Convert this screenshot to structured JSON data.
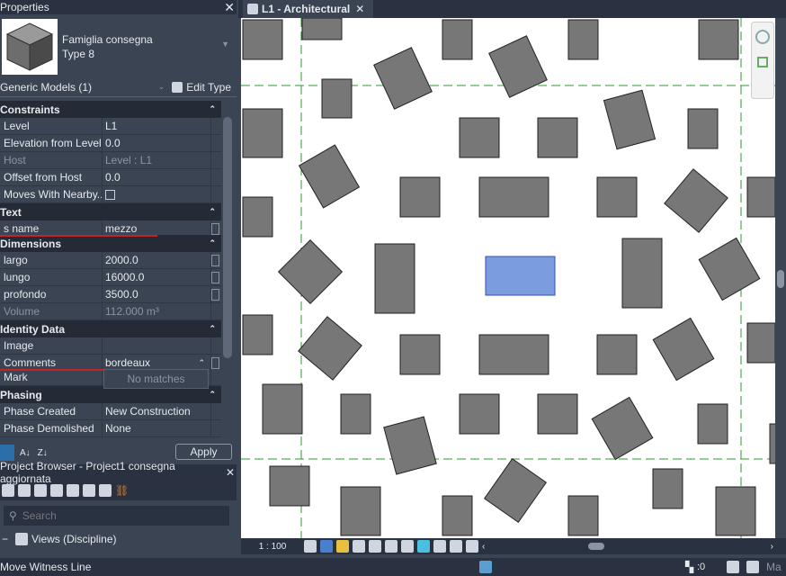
{
  "properties": {
    "title": "Properties",
    "family": "Famiglia consegna",
    "type": "Type 8",
    "category": "Generic Models (1)",
    "edit_type": "Edit Type",
    "sections": [
      {
        "name": "Constraints",
        "rows": [
          {
            "k": "Level",
            "v": "L1"
          },
          {
            "k": "Elevation from Level",
            "v": "0.0"
          },
          {
            "k": "Host",
            "v": "Level : L1",
            "dim": true
          },
          {
            "k": "Offset from Host",
            "v": "0.0"
          },
          {
            "k": "Moves With Nearby...",
            "v": "",
            "checkbox": true
          }
        ]
      },
      {
        "name": "Text",
        "rows": [
          {
            "k": "s name",
            "v": "mezzo",
            "box": true
          }
        ]
      },
      {
        "name": "Dimensions",
        "rows": [
          {
            "k": "largo",
            "v": "2000.0",
            "box": true
          },
          {
            "k": "lungo",
            "v": "16000.0",
            "box": true
          },
          {
            "k": "profondo",
            "v": "3500.0",
            "box": true
          },
          {
            "k": "Volume",
            "v": "112.000 m³",
            "dim": true
          }
        ]
      },
      {
        "name": "Identity Data",
        "rows": [
          {
            "k": "Image",
            "v": ""
          },
          {
            "k": "Comments",
            "v": "bordeaux",
            "box": true
          },
          {
            "k": "Mark",
            "v": ""
          }
        ]
      },
      {
        "name": "Phasing",
        "rows": [
          {
            "k": "Phase Created",
            "v": "New Construction"
          },
          {
            "k": "Phase Demolished",
            "v": "None"
          }
        ]
      }
    ],
    "dropdown_text": "No matches",
    "apply": "Apply"
  },
  "project_browser": {
    "title": "Project Browser - Project1 consegna aggiornata",
    "search_placeholder": "Search",
    "tree_item": "Views (Discipline)"
  },
  "view": {
    "tab": "L1 - Architectural",
    "scale": "1 : 100",
    "selected_color": "#7b9de0",
    "element_color": "#777777",
    "grid_color": "#2e9a2e"
  },
  "status": {
    "text": "Move Witness Line",
    "selection_count": ":0",
    "right_text": "Ma"
  }
}
